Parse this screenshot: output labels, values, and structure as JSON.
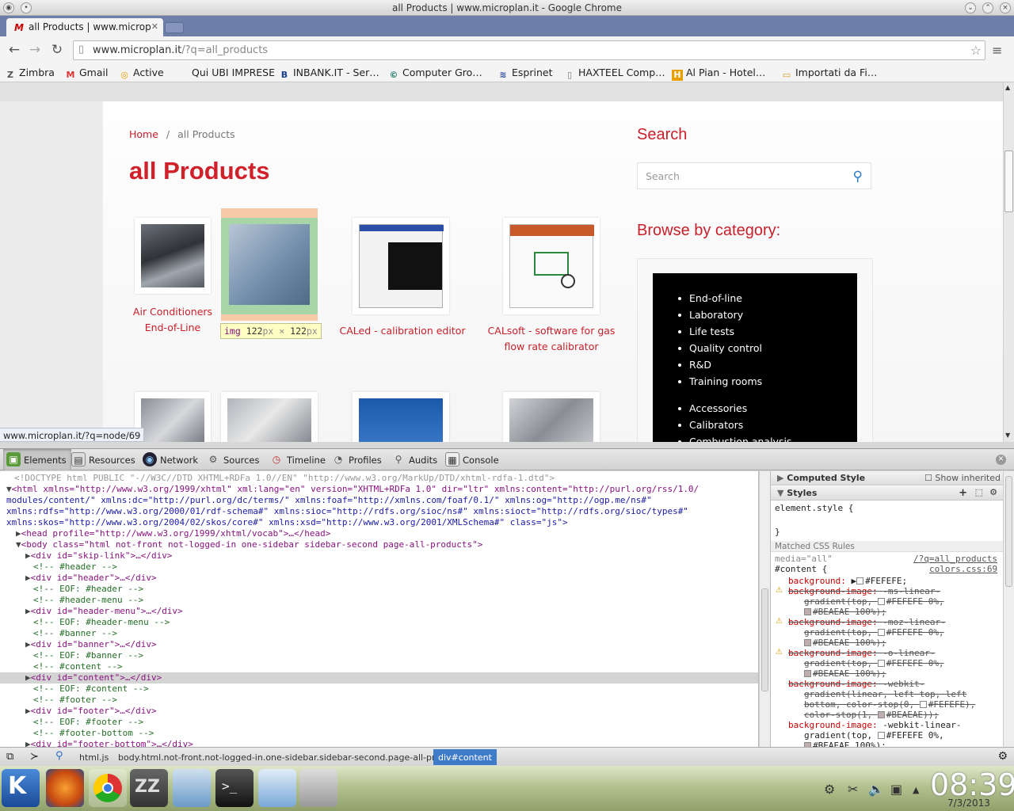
{
  "window": {
    "title": "all Products | www.microplan.it - Google Chrome"
  },
  "tab": {
    "label": "all Products | www.microp"
  },
  "address": {
    "host": "www.microplan.it",
    "path": "/?q=all_products"
  },
  "bookmarks": [
    "Zimbra",
    "Gmail",
    "Active",
    "Qui UBI IMPRESE",
    "INBANK.IT - Ser…",
    "Computer Gro…",
    "Esprinet",
    "HAXTEEL Comp…",
    "Al Pian - Hotel…",
    "Importati da Fi…"
  ],
  "page": {
    "breadcrumb": {
      "home": "Home",
      "sep": "/",
      "current": "all Products"
    },
    "title": "all Products",
    "products": [
      {
        "label1": "Air Conditioners",
        "label2": "End-of-Line"
      },
      {
        "label1": "CALed - calibration editor",
        "label2": ""
      },
      {
        "label1": "CALsoft - software for gas",
        "label2": "flow rate calibrator"
      }
    ],
    "dim_tooltip": {
      "tag": "img",
      "w": "122",
      "wu": "px",
      "x": "×",
      "h": "122",
      "hu": "px"
    },
    "search_heading": "Search",
    "search_placeholder": "Search",
    "browse_heading": "Browse by category:",
    "categories": [
      "End-of-line",
      "Laboratory",
      "Life tests",
      "Quality control",
      "R&D",
      "Training rooms",
      "Accessories",
      "Calibrators",
      "Combustion analysis"
    ],
    "status_url": "www.microplan.it/?q=node/69"
  },
  "devtools": {
    "tabs": [
      "Elements",
      "Resources",
      "Network",
      "Sources",
      "Timeline",
      "Profiles",
      "Audits",
      "Console"
    ],
    "dom": [
      "<!DOCTYPE html PUBLIC \"-//W3C//DTD XHTML+RDFa 1.0//EN\" \"http://www.w3.org/MarkUp/DTD/xhtml-rdfa-1.dtd\">",
      "<html xmlns=\"http://www.w3.org/1999/xhtml\" xml:lang=\"en\" version=\"XHTML+RDFa 1.0\" dir=\"ltr\" xmlns:content=\"http://purl.org/rss/1.0/",
      "modules/content/\" xmlns:dc=\"http://purl.org/dc/terms/\" xmlns:foaf=\"http://xmlns.com/foaf/0.1/\" xmlns:og=\"http://ogp.me/ns#\"",
      "xmlns:rdfs=\"http://www.w3.org/2000/01/rdf-schema#\" xmlns:sioc=\"http://rdfs.org/sioc/ns#\" xmlns:sioct=\"http://rdfs.org/sioc/types#\"",
      "xmlns:skos=\"http://www.w3.org/2004/02/skos/core#\" xmlns:xsd=\"http://www.w3.org/2001/XMLSchema#\" class=\"js\">",
      "<head profile=\"http://www.w3.org/1999/xhtml/vocab\">…</head>",
      "<body class=\"html not-front not-logged-in one-sidebar sidebar-second page-all-products\">",
      "<div id=\"skip-link\">…</div>",
      "<!-- #header -->",
      "<div id=\"header\">…</div>",
      "<!-- EOF: #header -->",
      "<!-- #header-menu -->",
      "<div id=\"header-menu\">…</div>",
      "<!-- EOF: #header-menu -->",
      "<!-- #banner -->",
      "<div id=\"banner\">…</div>",
      "<!-- EOF: #banner -->",
      "<!-- #content -->",
      "<div id=\"content\">…</div>",
      "<!-- EOF: #content -->",
      "<!-- #footer -->",
      "<div id=\"footer\">…</div>",
      "<!-- EOF: #footer -->",
      "<!-- #footer-bottom -->",
      "<div id=\"footer-bottom\">…</div>"
    ],
    "styles": {
      "computed": "Computed Style",
      "show_inherited": "Show inherited",
      "styles": "Styles",
      "element_style": "element.style {",
      "close": "}",
      "matched": "Matched CSS Rules",
      "media": "media=\"all\"",
      "src1": "/?q=all_products",
      "selector": "#content {",
      "src2": "colors.css:69",
      "bg": "background:",
      "bg_val": "#FEFEFE;",
      "bgi": "background-image:",
      "ms1": "-ms-linear-",
      "ms2": "gradient(top, ",
      "c1": "#FEFEFE 0%,",
      "c2": "#BEAEAE 100%);",
      "moz1": "-moz-linear-",
      "o1": "-o-linear-",
      "wk1": "-webkit-",
      "wk2": "gradient(linear, left top, left",
      "wk3": "bottom, color-stop(0, ",
      "wk3b": "#FEFEFE),",
      "wk4": "color-stop(1, ",
      "wk4b": "#BEAEAE));",
      "wl1": "-webkit-linear-",
      "wl2": "gradient(top, ",
      "wl2b": "#FEFEFE 0%,",
      "wl3": "#BEAEAE 100%);"
    },
    "crumbs": [
      "html.js",
      "body.html.not-front.not-logged-in.one-sidebar.sidebar-second.page-all-products",
      "div#content"
    ]
  },
  "taskbar": {
    "time": "08:39",
    "date": "7/3/2013"
  }
}
